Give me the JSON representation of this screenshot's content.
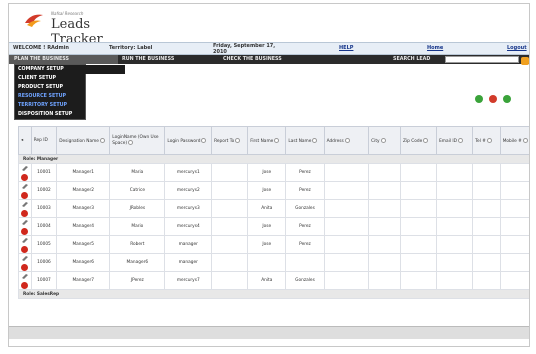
{
  "logo": {
    "small_text": "Nafsal Research",
    "title": "Leads Tracker"
  },
  "topbar": {
    "welcome": "WELCOME ! RAdmin",
    "territory": "Territory: Label",
    "date_line1": "Friday, September 17,",
    "date_line2": "2010",
    "help": "HELP",
    "home": "Home",
    "logout": "Logout"
  },
  "menu": {
    "plan": "PLAN THE BUSINESS",
    "run": "RUN THE BUSINESS",
    "check": "CHECK THE BUSINESS",
    "search_label": "SEARCH LEAD",
    "search_value": ""
  },
  "dropdown": {
    "company": "COMPANY SETUP",
    "client": "CLIENT SETUP",
    "product": "PRODUCT SETUP",
    "resource": "RESOURCE SETUP",
    "territory": "TERRITORY SETUP",
    "disposition": "DISPOSITION SETUP"
  },
  "colors": {
    "menu_bg": "#2b2b2b",
    "topbar_bg": "#e7eef6",
    "alt_link": "#6fa3ff"
  },
  "table": {
    "headers": {
      "rep_id": "Rep ID",
      "designation": "Designation Name",
      "login_name": "LoginName (Own Use Space)",
      "login_password": "Login Password",
      "report_to": "Report To",
      "first_name": "First Name",
      "last_name": "Last Name",
      "address": "Address",
      "city": "City",
      "zip": "Zip Code",
      "email": "Email ID",
      "tel": "Tel #",
      "mobile": "Mobile #"
    },
    "group_manager": "Role: Manager",
    "group_salesrep": "Role: SalesRep",
    "rows": [
      {
        "id": "10001",
        "designation": "Manager1",
        "login": "Maria",
        "password": "mercurys1",
        "first": "Jose",
        "last": "Perez"
      },
      {
        "id": "10002",
        "designation": "Manager2",
        "login": "Catrice",
        "password": "mercurys2",
        "first": "Jose",
        "last": "Perez"
      },
      {
        "id": "10003",
        "designation": "Manager3",
        "login": "JRobles",
        "password": "mercurys3",
        "first": "Anita",
        "last": "Gonzales"
      },
      {
        "id": "10004",
        "designation": "Manager4",
        "login": "Mario",
        "password": "mercurys4",
        "first": "Jose",
        "last": "Perez"
      },
      {
        "id": "10005",
        "designation": "Manager5",
        "login": "Robert",
        "password": "manager",
        "first": "Jose",
        "last": "Perez"
      },
      {
        "id": "10006",
        "designation": "Manager6",
        "login": "Manager6",
        "password": "manager",
        "first": "",
        "last": ""
      },
      {
        "id": "10007",
        "designation": "Manager7",
        "login": "JPerez",
        "password": "mercurys7",
        "first": "Anita",
        "last": "Gonzales"
      }
    ]
  }
}
